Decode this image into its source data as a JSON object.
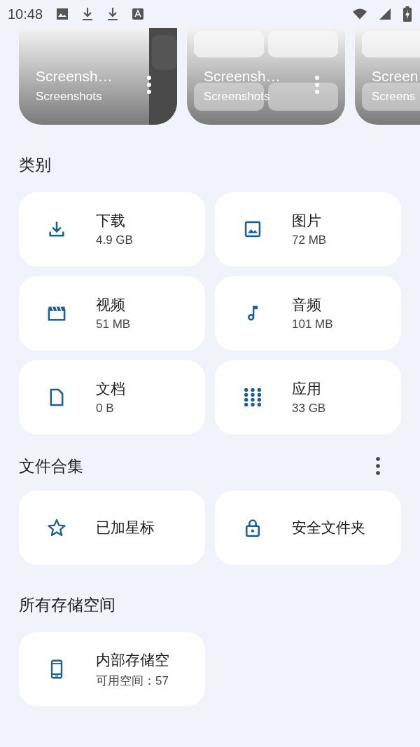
{
  "status_bar": {
    "time": "10:48"
  },
  "recent": [
    {
      "title": "Screensh…",
      "subtitle": "Screenshots"
    },
    {
      "title": "Screensh…",
      "subtitle": "Screenshots"
    },
    {
      "title": "Screen",
      "subtitle": "Screens"
    }
  ],
  "categories": {
    "title": "类别",
    "items": [
      {
        "name": "下载",
        "size": "4.9 GB"
      },
      {
        "name": "图片",
        "size": "72 MB"
      },
      {
        "name": "视频",
        "size": "51 MB"
      },
      {
        "name": "音频",
        "size": "101 MB"
      },
      {
        "name": "文档",
        "size": "0 B"
      },
      {
        "name": "应用",
        "size": "33 GB"
      }
    ]
  },
  "collections": {
    "title": "文件合集",
    "items": [
      {
        "name": "已加星标"
      },
      {
        "name": "安全文件夹"
      }
    ]
  },
  "storage": {
    "title": "所有存储空间",
    "items": [
      {
        "name": "内部存储空",
        "detail": "可用空间：57"
      }
    ]
  }
}
